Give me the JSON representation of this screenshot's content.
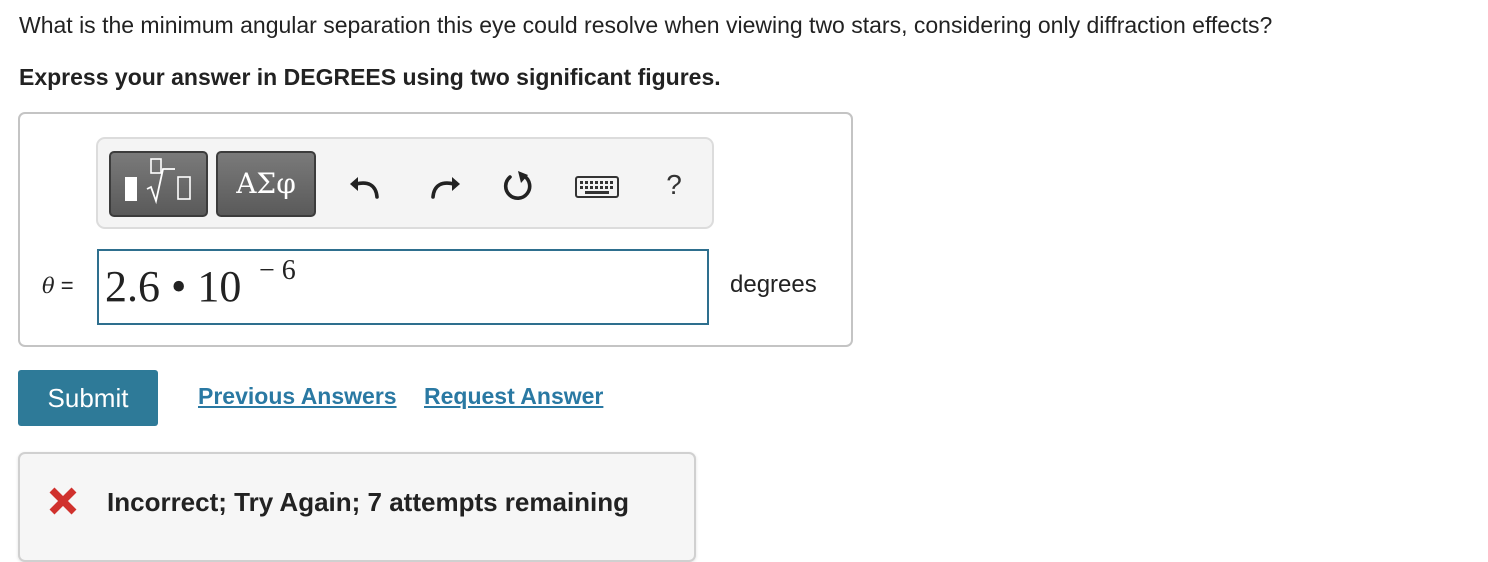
{
  "question": {
    "text": "What is the minimum angular separation this eye could resolve when viewing two stars, considering only diffraction effects?",
    "instruction": "Express your answer in DEGREES using two significant figures."
  },
  "toolbar": {
    "templates_button": "templates-icon",
    "symbols_label": "ΑΣφ",
    "undo": "undo-icon",
    "redo": "redo-icon",
    "reset": "reset-icon",
    "keyboard": "keyboard-icon",
    "help_label": "?"
  },
  "answer": {
    "variable": "θ",
    "equals": "=",
    "value_main": "2.6 • 10",
    "value_exponent": "− 6",
    "units": "degrees"
  },
  "actions": {
    "submit_label": "Submit",
    "previous_answers_label": "Previous Answers",
    "request_answer_label": "Request Answer"
  },
  "feedback": {
    "status_icon": "x-icon",
    "message": "Incorrect; Try Again; 7 attempts remaining",
    "color": "#d0312d"
  },
  "colors": {
    "accent": "#2e7a98",
    "link": "#2a79a3",
    "input_border": "#2e6f8e"
  }
}
